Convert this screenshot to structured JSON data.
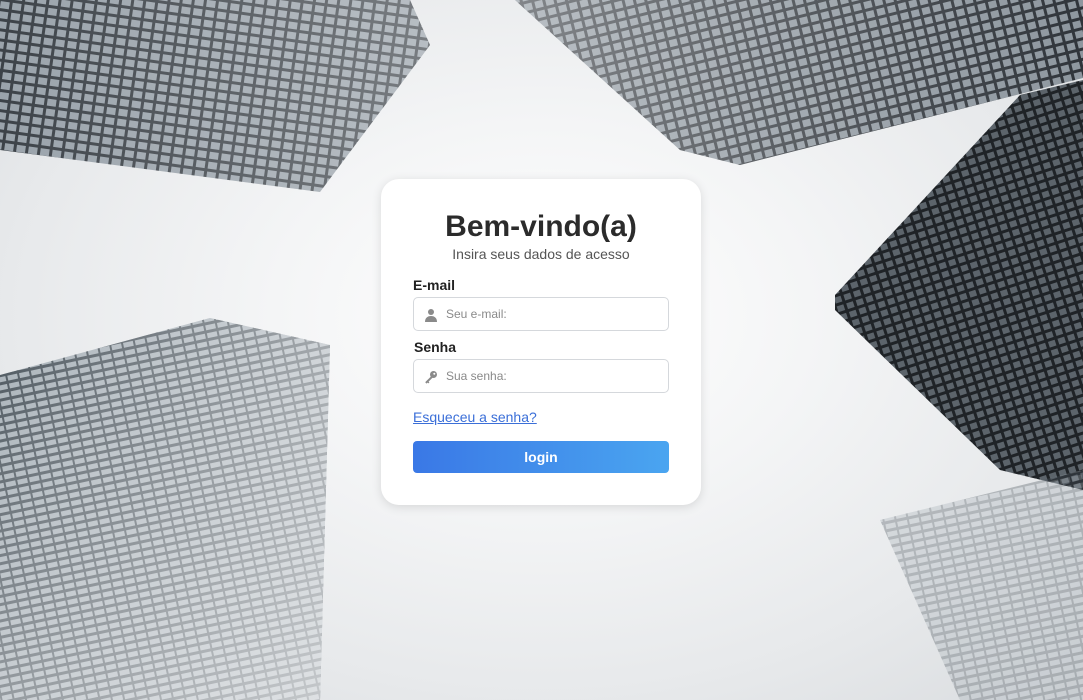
{
  "login": {
    "title": "Bem-vindo(a)",
    "subtitle": "Insira seus dados de acesso",
    "email_label": "E-mail",
    "email_placeholder": "Seu e-mail:",
    "email_icon": "user-icon",
    "password_label": "Senha",
    "password_placeholder": "Sua senha:",
    "password_icon": "key-icon",
    "forgot_link": "Esqueceu a senha?",
    "submit_label": "login"
  },
  "colors": {
    "button_gradient_start": "#3a78e6",
    "button_gradient_end": "#4aa5f0",
    "link": "#3b6fd8",
    "title": "#2b2b2b"
  },
  "background": {
    "description_icon": "skyscrapers-photo"
  }
}
